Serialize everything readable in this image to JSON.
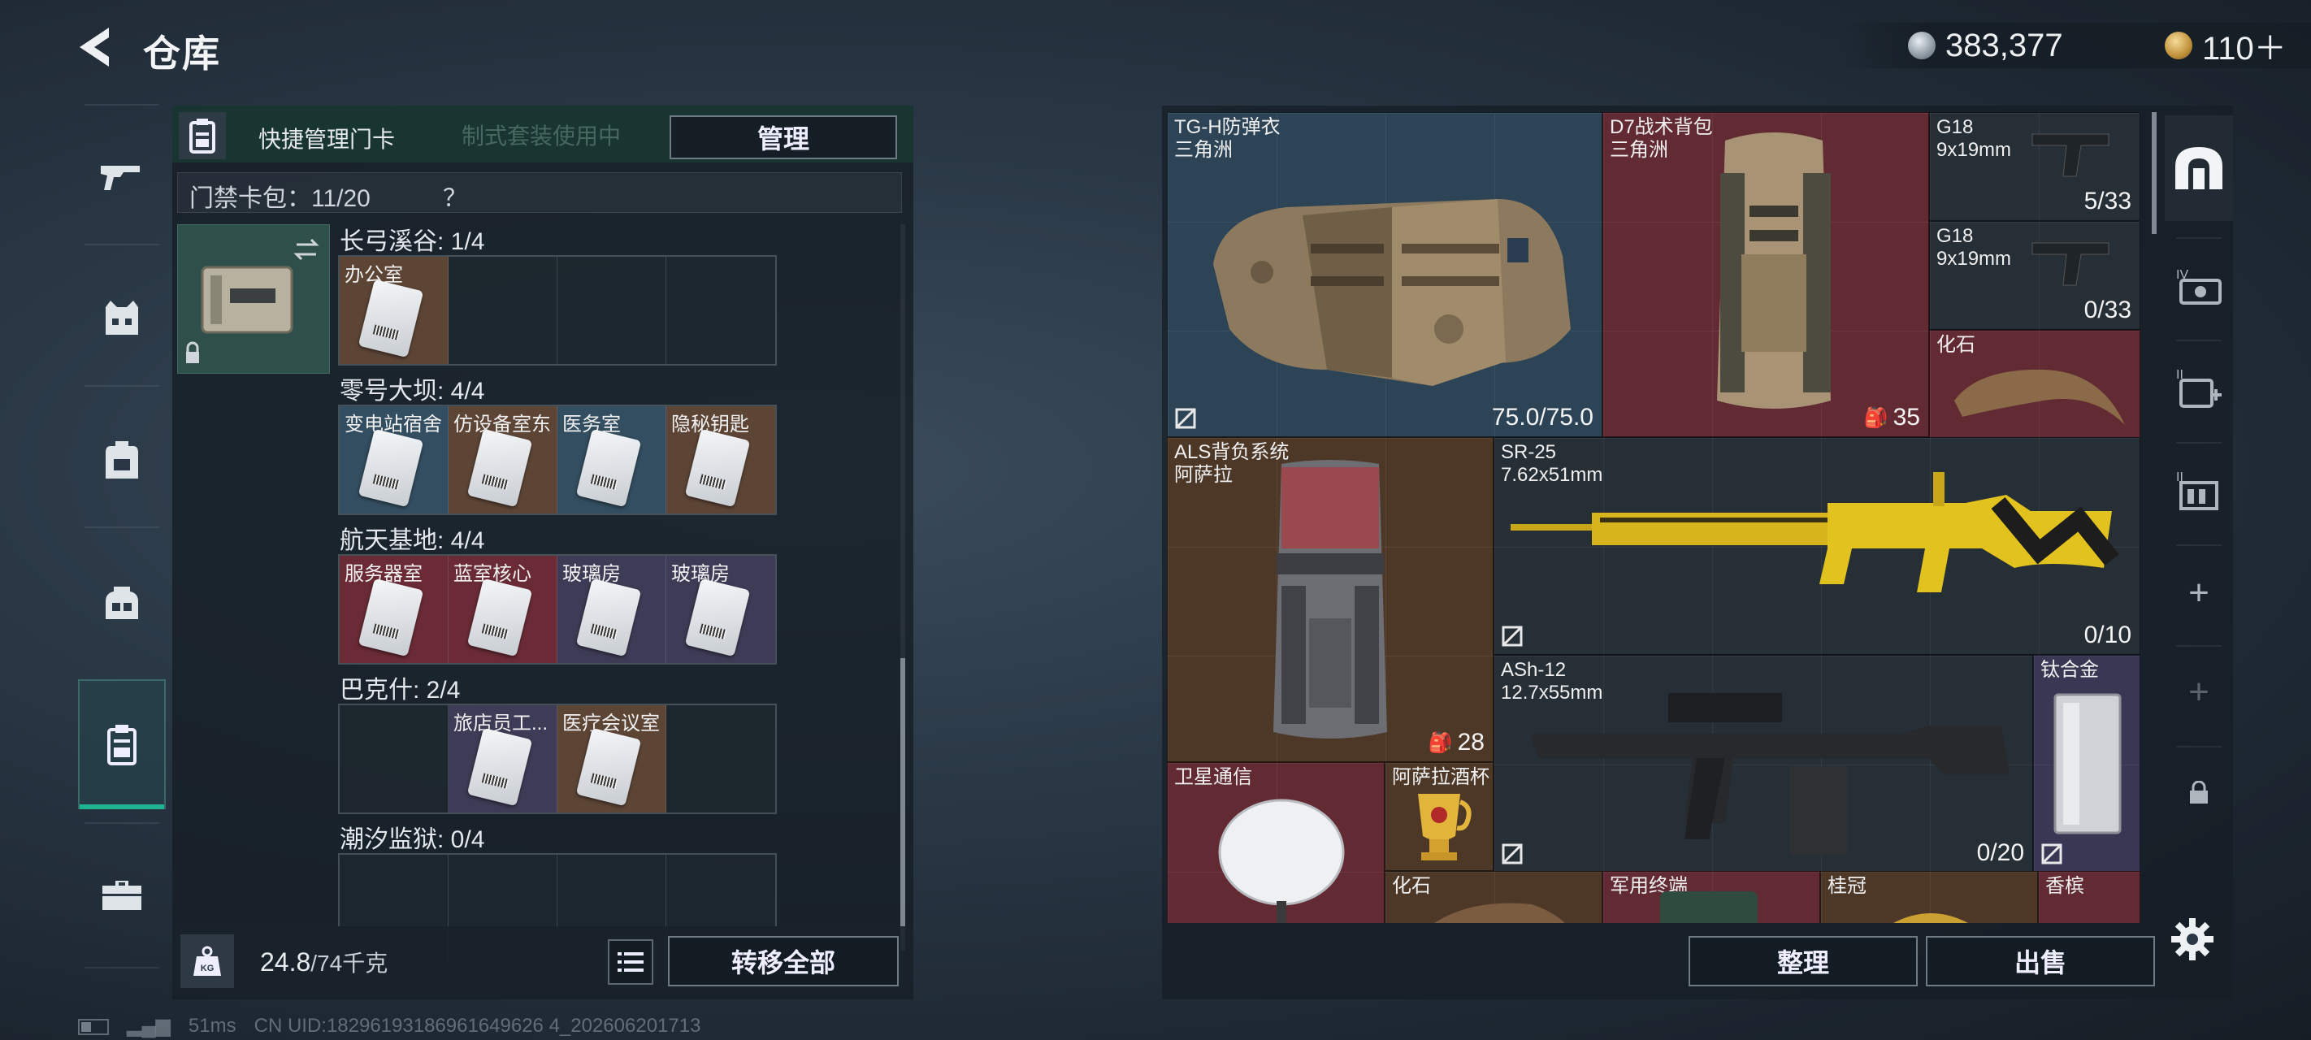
{
  "header": {
    "title": "仓库",
    "currencies": [
      {
        "icon": "silver-coin-icon",
        "value": "383,377"
      },
      {
        "icon": "gold-coin-icon",
        "value": "110＋"
      }
    ]
  },
  "left_nav": [
    {
      "name": "weapons",
      "icon": "gun-icon"
    },
    {
      "name": "armor",
      "icon": "vest-icon"
    },
    {
      "name": "backpack",
      "icon": "backpack-icon"
    },
    {
      "name": "chest-rig",
      "icon": "rig-icon"
    },
    {
      "name": "keycards",
      "icon": "keycard-icon",
      "active": true
    },
    {
      "name": "toolbox",
      "icon": "toolbox-icon"
    }
  ],
  "keycard_panel": {
    "header_title": "快捷管理门卡",
    "header_faded_text": "制式套装使用中",
    "manage_label": "管理",
    "pack_label": "门禁卡包：11/20",
    "help_symbol": "？",
    "sections": [
      {
        "label": "长弓溪谷: 1/4",
        "slots": [
          {
            "name": "办公室",
            "color": "brown"
          },
          {
            "name": "",
            "color": "empty"
          },
          {
            "name": "",
            "color": "empty"
          },
          {
            "name": "",
            "color": "empty"
          }
        ]
      },
      {
        "label": "零号大坝: 4/4",
        "slots": [
          {
            "name": "变电站宿舍",
            "color": "blue"
          },
          {
            "name": "仿设备室东",
            "color": "brown"
          },
          {
            "name": "医务室",
            "color": "blue"
          },
          {
            "name": "隐秘钥匙",
            "color": "brown"
          }
        ]
      },
      {
        "label": "航天基地: 4/4",
        "slots": [
          {
            "name": "服务器室",
            "color": "red"
          },
          {
            "name": "蓝室核心",
            "color": "red"
          },
          {
            "name": "玻璃房",
            "color": "purple"
          },
          {
            "name": "玻璃房",
            "color": "purple"
          }
        ]
      },
      {
        "label": "巴克什: 2/4",
        "slots": [
          {
            "name": "",
            "color": "empty"
          },
          {
            "name": "旅店员工...",
            "color": "purple"
          },
          {
            "name": "医疗会议室",
            "color": "brown"
          },
          {
            "name": "",
            "color": "empty"
          }
        ]
      },
      {
        "label": "潮汐监狱: 0/4",
        "slots": [
          {
            "name": "",
            "color": "empty"
          },
          {
            "name": "",
            "color": "empty"
          },
          {
            "name": "",
            "color": "empty"
          },
          {
            "name": "",
            "color": "empty"
          }
        ]
      }
    ],
    "weight_value": "24.8",
    "weight_capacity": "/74千克",
    "transfer_all_label": "转移全部"
  },
  "status": {
    "ping": "51ms",
    "uid": "CN UID:18296193186961649626 4_202606201713"
  },
  "inventory": {
    "items": [
      {
        "id": "armor",
        "name": "TG-H防弹衣",
        "sub": "三角洲",
        "stat": "75.0/75.0",
        "color": "blue"
      },
      {
        "id": "backpack",
        "name": "D7战术背包",
        "sub": "三角洲",
        "badge": "35",
        "color": "red"
      },
      {
        "id": "g18a",
        "name": "G18",
        "sub": "9x19mm",
        "stat": "5/33",
        "color": "dark"
      },
      {
        "id": "g18b",
        "name": "G18",
        "sub": "9x19mm",
        "stat": "0/33",
        "color": "dark"
      },
      {
        "id": "fossil1",
        "name": "化石",
        "sub": "",
        "color": "red"
      },
      {
        "id": "als",
        "name": "ALS背负系统",
        "sub": "阿萨拉",
        "badge": "28",
        "color": "brown"
      },
      {
        "id": "sr25",
        "name": "SR-25",
        "sub": "7.62x51mm",
        "stat": "0/10",
        "color": "dark"
      },
      {
        "id": "ash12",
        "name": "ASh-12",
        "sub": "12.7x55mm",
        "stat": "0/20",
        "color": "dark"
      },
      {
        "id": "titanium",
        "name": "钛合金",
        "sub": "",
        "color": "purple"
      },
      {
        "id": "satcom",
        "name": "卫星通信",
        "sub": "",
        "color": "red"
      },
      {
        "id": "cup",
        "name": "阿萨拉酒杯",
        "sub": "",
        "color": "brown"
      },
      {
        "id": "fossil2",
        "name": "化石",
        "sub": "",
        "color": "brown"
      },
      {
        "id": "terminal",
        "name": "军用终端",
        "sub": "",
        "color": "red"
      },
      {
        "id": "laurel",
        "name": "桂冠",
        "sub": "",
        "color": "brown"
      },
      {
        "id": "champagne",
        "name": "香槟",
        "sub": "",
        "color": "red"
      }
    ],
    "sort_label": "整理",
    "sell_label": "出售"
  },
  "side_tools": [
    {
      "icon": "safe-box-icon"
    },
    {
      "icon": "level-iv-armor-icon"
    },
    {
      "icon": "add-medkit-icon"
    },
    {
      "icon": "storage-expansion-icon"
    },
    {
      "icon": "plus-icon",
      "label": "+"
    },
    {
      "icon": "plus-icon",
      "label": "+"
    },
    {
      "icon": "lock-icon"
    }
  ],
  "colors": {
    "accent": "#1fb38f",
    "rarity_blue": "#2c4456",
    "rarity_red": "#622a33",
    "rarity_brown": "#4d3828",
    "rarity_purple": "#383754"
  }
}
